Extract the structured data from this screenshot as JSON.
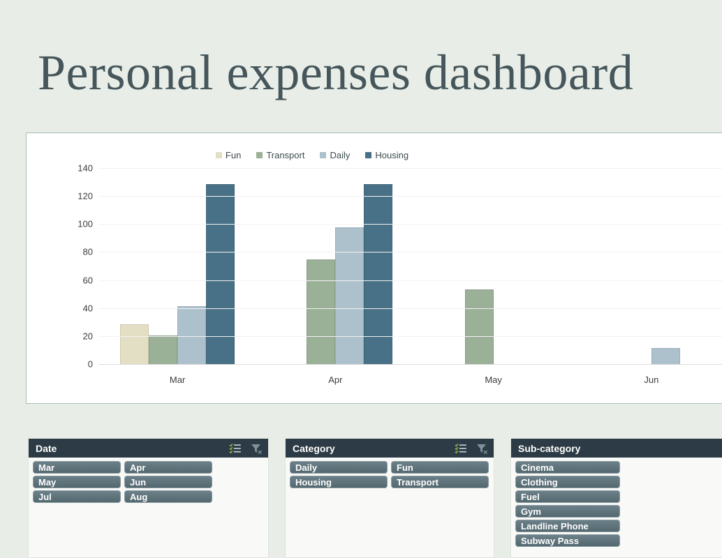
{
  "header": {
    "title": "Personal expenses dashboard"
  },
  "chart_data": {
    "type": "bar",
    "title": "",
    "subtitle": "",
    "xlabel": "",
    "ylabel": "",
    "categories": [
      "Mar",
      "Apr",
      "May",
      "Jun"
    ],
    "series": [
      {
        "name": "Fun",
        "color": "#e3dfc4",
        "values": [
          29,
          0,
          0,
          0
        ]
      },
      {
        "name": "Transport",
        "color": "#9ab097",
        "values": [
          21,
          75,
          54,
          0
        ]
      },
      {
        "name": "Daily",
        "color": "#adc1cd",
        "values": [
          42,
          98,
          0,
          12
        ]
      },
      {
        "name": "Housing",
        "color": "#487086",
        "values": [
          129,
          129,
          0,
          0
        ]
      }
    ],
    "ylim": [
      0,
      140
    ],
    "yticks": [
      0,
      20,
      40,
      60,
      80,
      100,
      120,
      140
    ],
    "ytick_labels": [
      "0",
      "20",
      "40",
      "60",
      "80",
      "100",
      "120",
      "140"
    ],
    "grid": true,
    "legend_position": "top",
    "legend_entries": [
      "Fun",
      "Transport",
      "Daily",
      "Housing"
    ]
  },
  "slicers": [
    {
      "id": "date",
      "title": "Date",
      "multiselect_icon": "multi-select-icon",
      "clear_filter_icon": "clear-filter-icon",
      "items": [
        "Mar",
        "Apr",
        "May",
        "Jun",
        "Jul",
        "Aug"
      ]
    },
    {
      "id": "category",
      "title": "Category",
      "multiselect_icon": "multi-select-icon",
      "clear_filter_icon": "clear-filter-icon",
      "items": [
        "Daily",
        "Fun",
        "Housing",
        "Transport"
      ]
    },
    {
      "id": "subcategory",
      "title": "Sub-category",
      "multiselect_icon": "multi-select-icon",
      "clear_filter_icon": "clear-filter-icon",
      "items": [
        "Cinema",
        "Clothing",
        "Fuel",
        "Gym",
        "Landline Phone",
        "Subway Pass"
      ]
    }
  ],
  "colors": {
    "page_background": "#e8eee7",
    "title_text": "#46565b",
    "panel_background": "#ffffff",
    "panel_border": "#a9bdb0",
    "slicer_header": "#2c3b45",
    "slicer_item": "#56707a",
    "slicer_body": "#f9faf7",
    "fun": "#e3dfc4",
    "transport": "#9ab097",
    "daily": "#adc1cd",
    "housing": "#487086"
  }
}
